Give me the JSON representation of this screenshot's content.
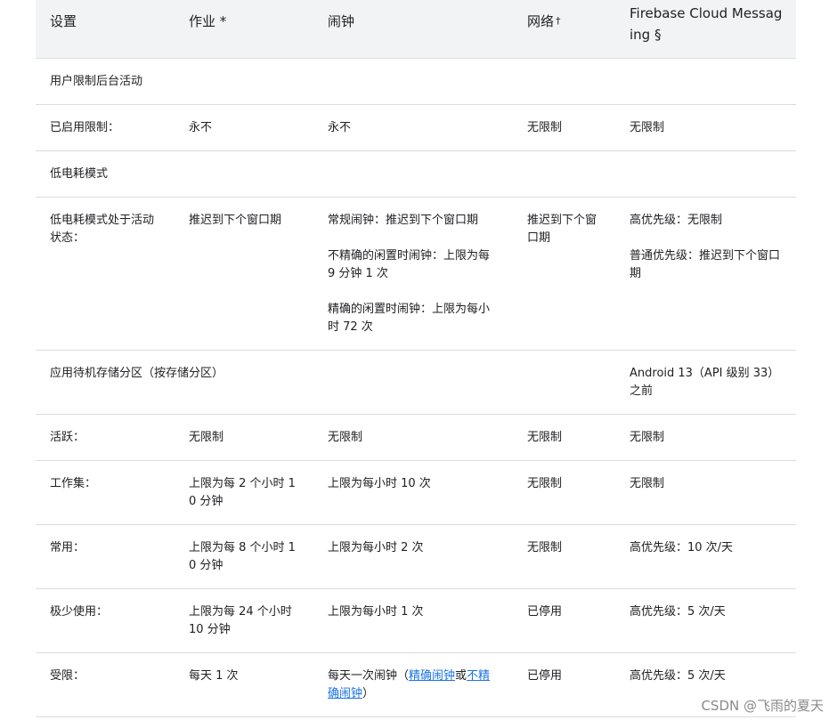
{
  "header": {
    "col1": "设置",
    "col2": "作业 *",
    "col3": "闹钟",
    "col4": "网络",
    "col4_mark": "†",
    "col5": "Firebase Cloud Messaging §"
  },
  "sections": {
    "user_restriction": "用户限制后台活动",
    "low_power": "低电耗模式",
    "standby_buckets": "应用待机存储分区（按存储分区）"
  },
  "rows": {
    "restriction_enabled": {
      "label": "已启用限制：",
      "jobs": "永不",
      "alarms": "永不",
      "network": "无限制",
      "fcm": "无限制"
    },
    "low_power_active": {
      "label": "低电耗模式处于活动状态：",
      "jobs": "推迟到下个窗口期",
      "alarms_1": "常规闹钟：推迟到下个窗口期",
      "alarms_2": "不精确的闲置时闹钟：上限为每 9 分钟 1 次",
      "alarms_3": "精确的闲置时闹钟：上限为每小时 72 次",
      "network": "推迟到下个窗口期",
      "fcm_1": "高优先级：无限制",
      "fcm_2": "普通优先级：推迟到下个窗口期"
    },
    "standby_fcm_note": "Android 13（API 级别 33）之前",
    "active": {
      "label": "活跃：",
      "jobs": "无限制",
      "alarms": "无限制",
      "network": "无限制",
      "fcm": "无限制"
    },
    "working_set": {
      "label": "工作集：",
      "jobs": "上限为每 2 个小时 10 分钟",
      "alarms": "上限为每小时 10 次",
      "network": "无限制",
      "fcm": "无限制"
    },
    "frequent": {
      "label": "常用：",
      "jobs": "上限为每 8 个小时 10 分钟",
      "alarms": "上限为每小时 2 次",
      "network": "无限制",
      "fcm": "高优先级：10 次/天"
    },
    "rare": {
      "label": "极少使用：",
      "jobs": "上限为每 24 个小时 10 分钟",
      "alarms": "上限为每小时 1 次",
      "network": "已停用",
      "fcm": "高优先级：5 次/天"
    },
    "restricted": {
      "label": "受限：",
      "jobs": "每天 1 次",
      "alarms_prefix": "每天一次闹钟（",
      "alarms_link1": "精确闹钟",
      "alarms_mid": "或",
      "alarms_link2": "不精确闹钟",
      "alarms_suffix": "）",
      "network": "已停用",
      "fcm": "高优先级：5 次/天"
    }
  },
  "watermark": "CSDN @飞雨的夏天"
}
